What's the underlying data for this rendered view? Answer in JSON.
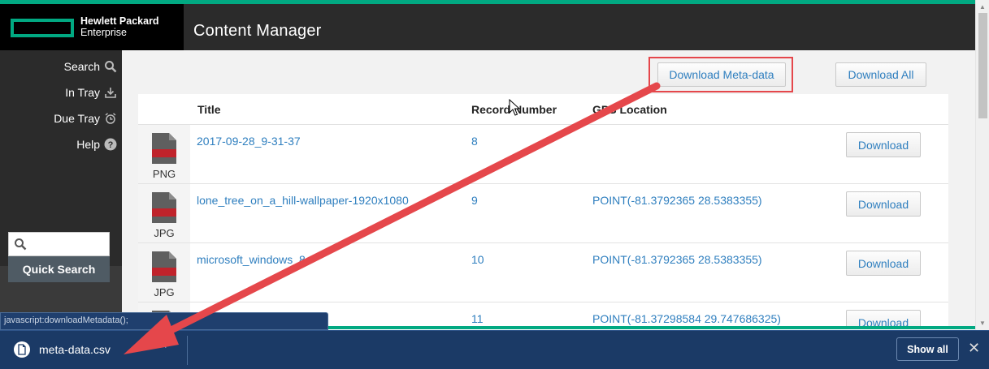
{
  "brand": {
    "line1": "Hewlett Packard",
    "line2": "Enterprise",
    "accent_color": "#01a982"
  },
  "app_title": "Content Manager",
  "sidebar": {
    "items": [
      {
        "label": "Search",
        "icon": "search-icon"
      },
      {
        "label": "In Tray",
        "icon": "tray-download-icon"
      },
      {
        "label": "Due Tray",
        "icon": "alarm-clock-icon"
      },
      {
        "label": "Help",
        "icon": "help-circle-icon"
      }
    ],
    "search_value": "",
    "quick_search_label": "Quick Search"
  },
  "toolbar": {
    "download_metadata_label": "Download Meta-data",
    "download_all_label": "Download All",
    "highlight_color": "#e5474b"
  },
  "table": {
    "columns": [
      "Title",
      "Record Number",
      "GPS Location"
    ],
    "rows": [
      {
        "type": "PNG",
        "title": "2017-09-28_9-31-37",
        "record_number": "8",
        "gps": "",
        "action": "Download"
      },
      {
        "type": "JPG",
        "title": "lone_tree_on_a_hill-wallpaper-1920x1080",
        "record_number": "9",
        "gps": "POINT(-81.3792365 28.5383355)",
        "action": "Download"
      },
      {
        "type": "JPG",
        "title": "microsoft_windows_8",
        "record_number": "10",
        "gps": "POINT(-81.3792365 28.5383355)",
        "action": "Download"
      },
      {
        "type": "",
        "title": "",
        "record_number": "11",
        "gps": "POINT(-81.37298584 29.747686325)",
        "action": "Download"
      }
    ]
  },
  "status_bar_text": "javascript:downloadMetadata();",
  "downloads_bar": {
    "file_name": "meta-data.csv",
    "show_all_label": "Show all",
    "close_symbol": "✕",
    "chevron_symbol": "^"
  }
}
